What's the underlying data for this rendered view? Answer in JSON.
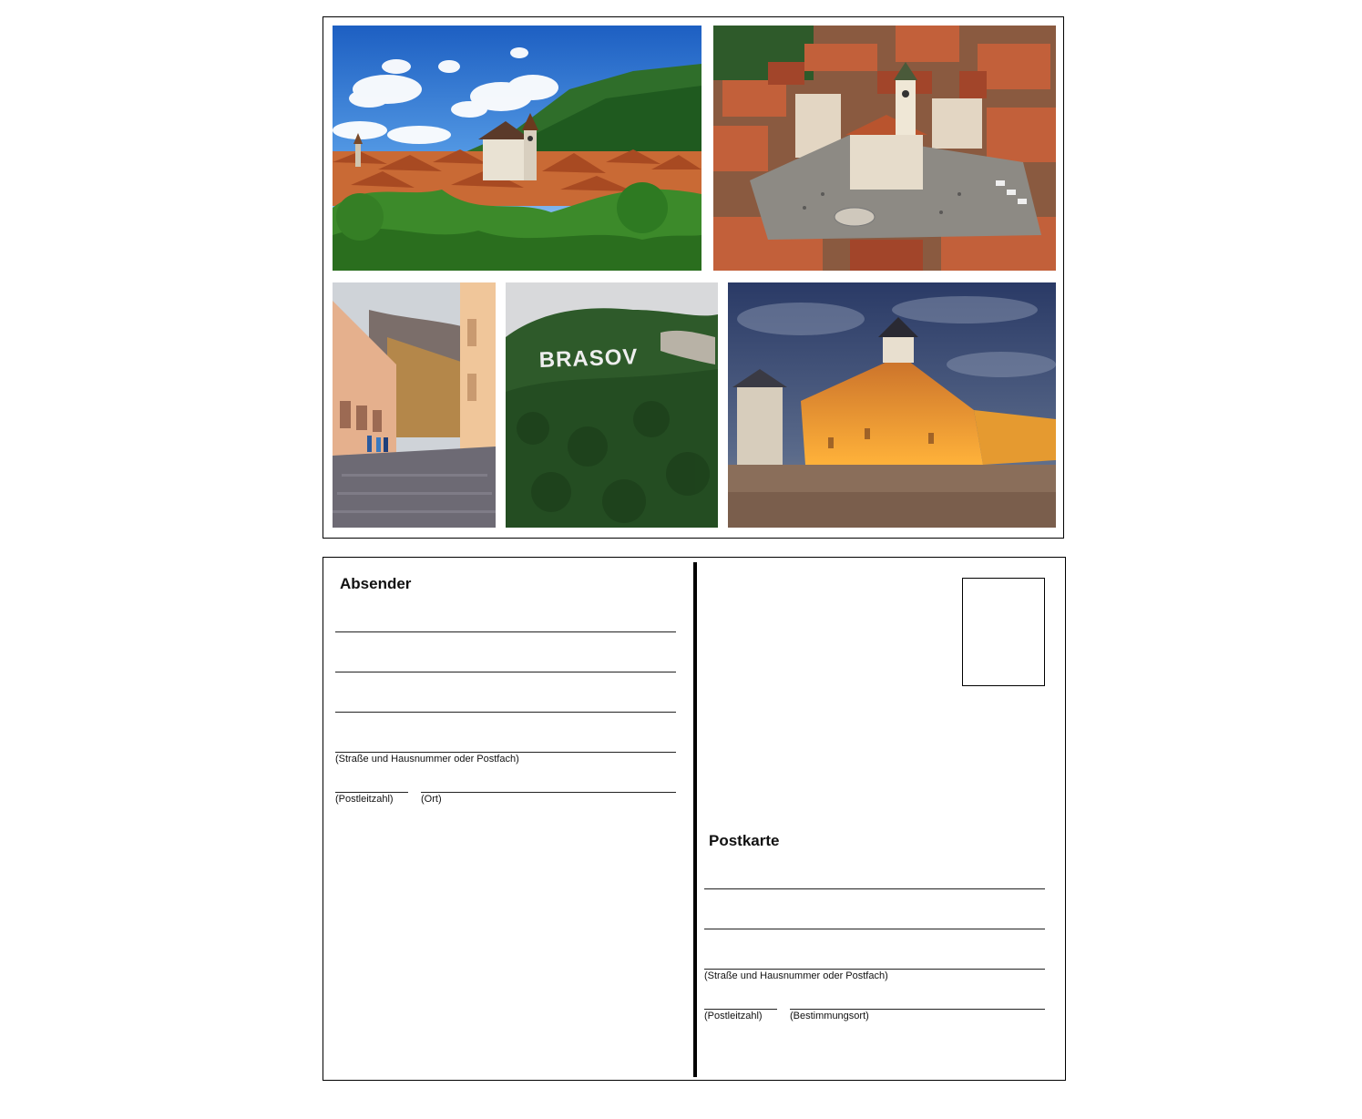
{
  "front": {
    "photos": [
      {
        "subject": "Brasov old town panorama with Black Church and Tampa mountain"
      },
      {
        "subject": "Aerial view of Council Square with the old town hall tower"
      },
      {
        "subject": "Wet pedestrian street with arcaded houses"
      },
      {
        "subject": "Brasov sign on the forested Tampa hill",
        "sign_text": "BRASOV"
      },
      {
        "subject": "Illuminated medieval fortress bastion at dusk"
      }
    ]
  },
  "back": {
    "sender": {
      "heading": "Absender",
      "street_hint": "(Straße und Hausnummer oder Postfach)",
      "postcode_hint": "(Postleitzahl)",
      "city_hint": "(Ort)"
    },
    "recipient": {
      "heading": "Postkarte",
      "street_hint": "(Straße und Hausnummer oder Postfach)",
      "postcode_hint": "(Postleitzahl)",
      "city_hint": "(Bestimmungsort)"
    },
    "colors": {
      "border": "#000000",
      "line": "#222222"
    }
  }
}
